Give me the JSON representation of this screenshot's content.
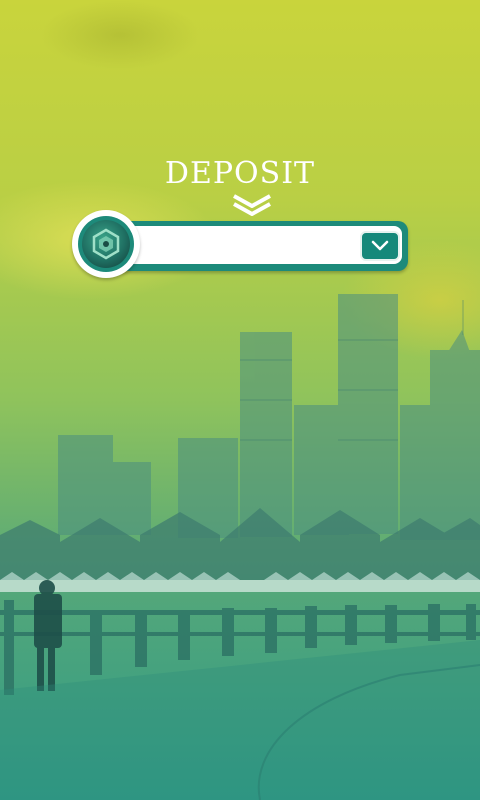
{
  "screen": {
    "title": "DEPOSIT"
  },
  "selector": {
    "selected_value": "",
    "coin_icon": "coin-logo-icon",
    "dropdown_icon": "chevron-down-icon"
  },
  "decor": {
    "arrow_icon": "double-chevron-down-icon"
  },
  "colors": {
    "accent": "#1d8a7a",
    "bar_fill": "#ffffff",
    "title": "#ffffff"
  }
}
